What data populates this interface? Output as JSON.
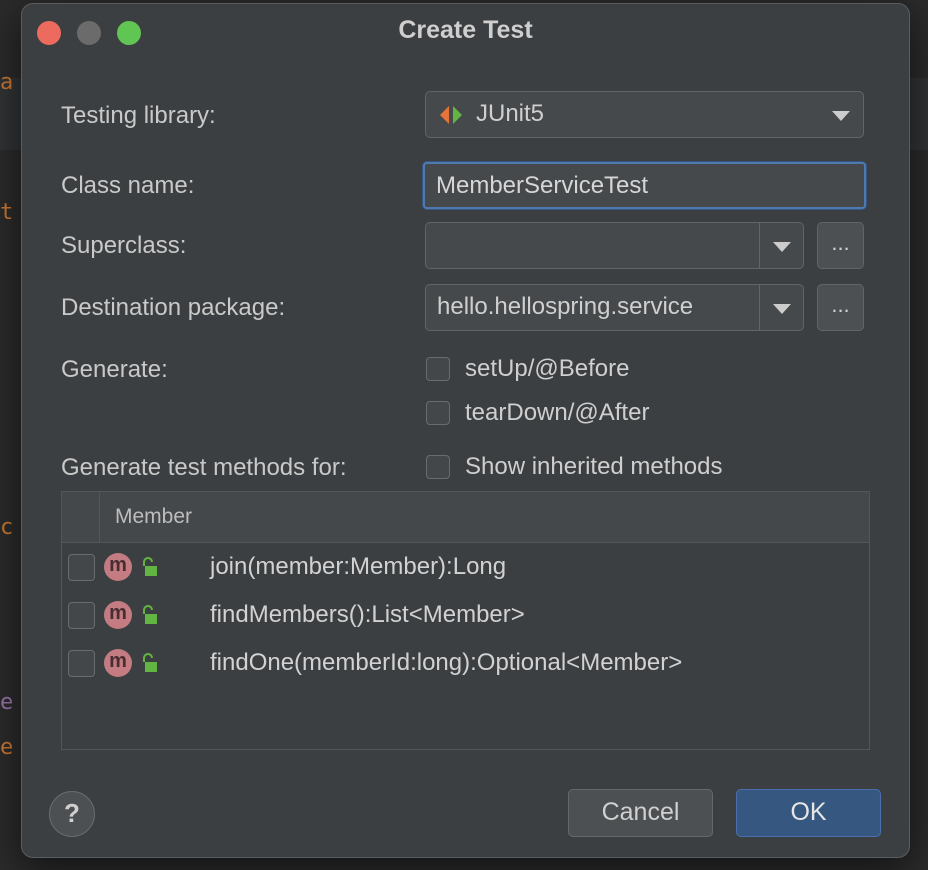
{
  "dialog": {
    "title": "Create Test",
    "testing_library": {
      "label": "Testing library:",
      "value": "JUnit5",
      "icon": "junit-icon"
    },
    "class_name": {
      "label": "Class name:",
      "value": "MemberServiceTest"
    },
    "superclass": {
      "label": "Superclass:",
      "value": "",
      "browse_label": "..."
    },
    "destination_package": {
      "label": "Destination package:",
      "value": "hello.hellospring.service",
      "browse_label": "..."
    },
    "generate": {
      "label": "Generate:",
      "options": [
        {
          "label": "setUp/@Before",
          "checked": false
        },
        {
          "label": "tearDown/@After",
          "checked": false
        }
      ]
    },
    "methods": {
      "label": "Generate test methods for:",
      "show_inherited": {
        "label": "Show inherited methods",
        "checked": false
      },
      "column_header": "Member",
      "rows": [
        {
          "icon_letter": "m",
          "signature": "join(member:Member):Long",
          "checked": false
        },
        {
          "icon_letter": "m",
          "signature": "findMembers():List<Member>",
          "checked": false
        },
        {
          "icon_letter": "m",
          "signature": "findOne(memberId:long):Optional<Member>",
          "checked": false
        }
      ]
    },
    "buttons": {
      "help": "?",
      "cancel": "Cancel",
      "ok": "OK"
    }
  },
  "colors": {
    "dialog_bg": "#3c3f41",
    "accent_ok": "#365880",
    "focus_border": "#4f7ab0",
    "method_icon": "#c47c83",
    "traffic_close": "#ec6a5e",
    "traffic_min": "#6b6b6b",
    "traffic_zoom": "#61c554"
  }
}
